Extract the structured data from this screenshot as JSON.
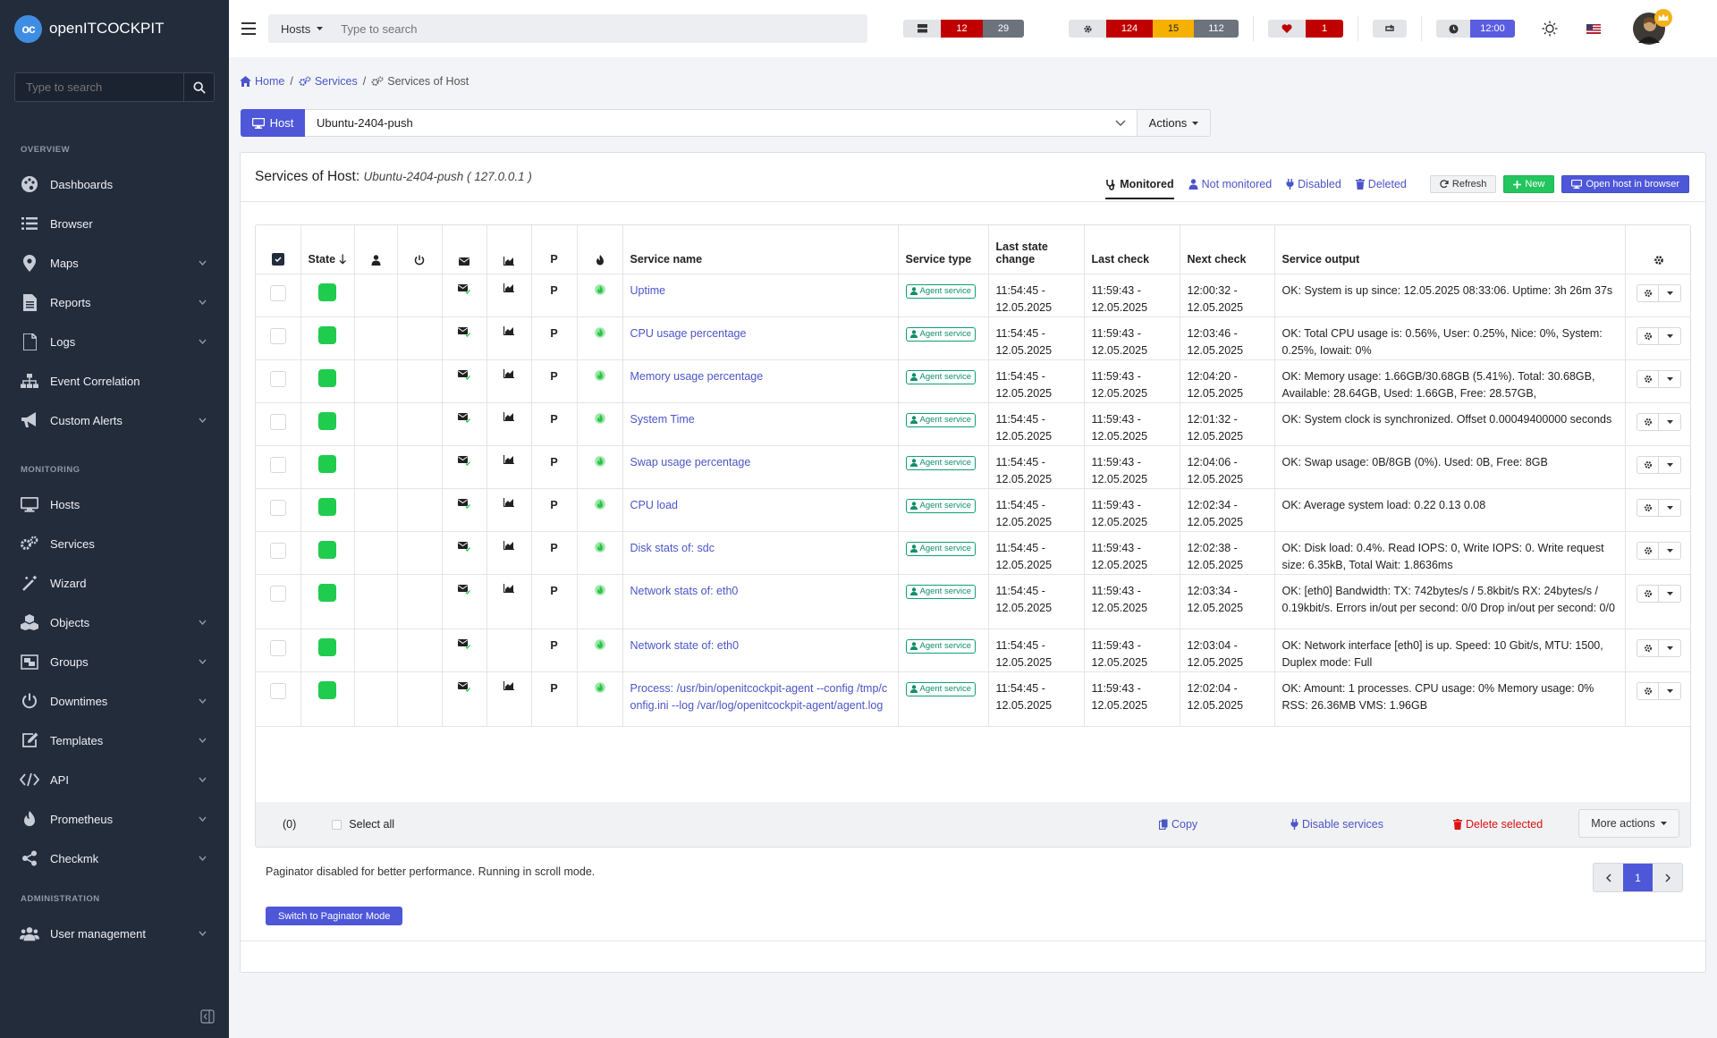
{
  "app": {
    "logo_text": "openITCOCKPIT",
    "logo_mark": "oc"
  },
  "sidebar": {
    "search_placeholder": "Type to search",
    "sections": {
      "overview": "OVERVIEW",
      "monitoring": "MONITORING",
      "administration": "ADMINISTRATION"
    },
    "overview_items": [
      {
        "label": "Dashboards",
        "icon": "palette-icon",
        "chevron": false
      },
      {
        "label": "Browser",
        "icon": "list-icon",
        "chevron": false
      },
      {
        "label": "Maps",
        "icon": "map-pin-icon",
        "chevron": true
      },
      {
        "label": "Reports",
        "icon": "file-report-icon",
        "chevron": true
      },
      {
        "label": "Logs",
        "icon": "file-icon",
        "chevron": true
      },
      {
        "label": "Event Correlation",
        "icon": "sitemap-icon",
        "chevron": false
      },
      {
        "label": "Custom Alerts",
        "icon": "bullhorn-icon",
        "chevron": true
      }
    ],
    "monitoring_items": [
      {
        "label": "Hosts",
        "icon": "desktop-icon",
        "chevron": false
      },
      {
        "label": "Services",
        "icon": "gears-icon",
        "chevron": false
      },
      {
        "label": "Wizard",
        "icon": "magic-wand-icon",
        "chevron": false
      },
      {
        "label": "Objects",
        "icon": "cubes-icon",
        "chevron": true
      },
      {
        "label": "Groups",
        "icon": "object-group-icon",
        "chevron": true
      },
      {
        "label": "Downtimes",
        "icon": "power-icon",
        "chevron": true
      },
      {
        "label": "Templates",
        "icon": "edit-icon",
        "chevron": true
      },
      {
        "label": "API",
        "icon": "code-icon",
        "chevron": true
      },
      {
        "label": "Prometheus",
        "icon": "fire-icon",
        "chevron": true
      },
      {
        "label": "Checkmk",
        "icon": "share-icon",
        "chevron": true
      }
    ],
    "administration_items": [
      {
        "label": "User management",
        "icon": "users-icon",
        "chevron": true
      }
    ]
  },
  "topbar": {
    "search_type": "Hosts",
    "search_placeholder": "Type to search",
    "host_counts": {
      "down": "12",
      "unreachable": "29"
    },
    "service_counts": {
      "critical": "124",
      "warning": "15",
      "unknown": "112"
    },
    "health_count": "1",
    "clock": "12:00",
    "colors": {
      "red": "#c00000",
      "amber": "#f6b000",
      "gray": "#6c737d",
      "purple": "#5a5de0"
    }
  },
  "breadcrumb": {
    "home": "Home",
    "services": "Services",
    "current": "Services of Host"
  },
  "hostbar": {
    "host_button": "Host",
    "selected_host": "Ubuntu-2404-push",
    "actions": "Actions"
  },
  "card": {
    "title_prefix": "Services of Host:",
    "title_host": "Ubuntu-2404-push ( 127.0.0.1 )",
    "tabs": {
      "monitored": "Monitored",
      "not_monitored": "Not monitored",
      "disabled": "Disabled",
      "deleted": "Deleted"
    },
    "buttons": {
      "refresh": "Refresh",
      "new": "New",
      "open": "Open host in browser"
    }
  },
  "table": {
    "headers": {
      "state": "State",
      "p": "P",
      "service_name": "Service name",
      "service_type": "Service type",
      "last_state_change": "Last state change",
      "last_check": "Last check",
      "next_check": "Next check",
      "service_output": "Service output"
    },
    "rows": [
      {
        "name": "Uptime",
        "type": "Agent service",
        "last_change": "11:54:45 - 12.05.2025",
        "last_check": "11:59:43 - 12.05.2025",
        "next_check": "12:00:32 - 12.05.2025",
        "output": "OK: System is up since: 12.05.2025 08:33:06. Uptime: 3h 26m 37s",
        "graph": true,
        "p": "P"
      },
      {
        "name": "CPU usage percentage",
        "type": "Agent service",
        "last_change": "11:54:45 - 12.05.2025",
        "last_check": "11:59:43 - 12.05.2025",
        "next_check": "12:03:46 - 12.05.2025",
        "output": "OK: Total CPU usage is: 0.56%, User: 0.25%, Nice: 0%, System: 0.25%, Iowait: 0%",
        "graph": true,
        "p": "P"
      },
      {
        "name": "Memory usage percentage",
        "type": "Agent service",
        "last_change": "11:54:45 - 12.05.2025",
        "last_check": "11:59:43 - 12.05.2025",
        "next_check": "12:04:20 - 12.05.2025",
        "output": "OK: Memory usage: 1.66GB/30.68GB (5.41%). Total: 30.68GB, Available: 28.64GB, Used: 1.66GB, Free: 28.57GB,",
        "graph": true,
        "p": "P"
      },
      {
        "name": "System Time",
        "type": "Agent service",
        "last_change": "11:54:45 - 12.05.2025",
        "last_check": "11:59:43 - 12.05.2025",
        "next_check": "12:01:32 - 12.05.2025",
        "output": "OK: System clock is synchronized. Offset 0.00049400000 seconds",
        "graph": true,
        "p": "P"
      },
      {
        "name": "Swap usage percentage",
        "type": "Agent service",
        "last_change": "11:54:45 - 12.05.2025",
        "last_check": "11:59:43 - 12.05.2025",
        "next_check": "12:04:06 - 12.05.2025",
        "output": "OK: Swap usage: 0B/8GB (0%). Used: 0B, Free: 8GB",
        "graph": true,
        "p": "P"
      },
      {
        "name": "CPU load",
        "type": "Agent service",
        "last_change": "11:54:45 - 12.05.2025",
        "last_check": "11:59:43 - 12.05.2025",
        "next_check": "12:02:34 - 12.05.2025",
        "output": "OK: Average system load: 0.22 0.13 0.08",
        "graph": true,
        "p": "P"
      },
      {
        "name": "Disk stats of: sdc",
        "type": "Agent service",
        "last_change": "11:54:45 - 12.05.2025",
        "last_check": "11:59:43 - 12.05.2025",
        "next_check": "12:02:38 - 12.05.2025",
        "output": "OK: Disk load: 0.4%. Read IOPS: 0, Write IOPS: 0. Write request size: 6.35kB, Total Wait: 1.8636ms",
        "graph": true,
        "p": "P"
      },
      {
        "name": "Network stats of: eth0",
        "type": "Agent service",
        "last_change": "11:54:45 - 12.05.2025",
        "last_check": "11:59:43 - 12.05.2025",
        "next_check": "12:03:34 - 12.05.2025",
        "output": "OK: [eth0] Bandwidth: TX: 742bytes/s / 5.8kbit/s RX: 24bytes/s / 0.19kbit/s. Errors in/out per second: 0/0 Drop in/out per second: 0/0",
        "graph": true,
        "p": "P"
      },
      {
        "name": "Network state of: eth0",
        "type": "Agent service",
        "last_change": "11:54:45 - 12.05.2025",
        "last_check": "11:59:43 - 12.05.2025",
        "next_check": "12:03:04 - 12.05.2025",
        "output": "OK: Network interface [eth0] is up. Speed: 10 Gbit/s, MTU: 1500, Duplex mode: Full",
        "graph": false,
        "p": "P"
      },
      {
        "name": "Process: /usr/bin/openitcockpit-agent --config /tmp/config.ini --log /var/log/openitcockpit-agent/agent.log",
        "type": "Agent service",
        "last_change": "11:54:45 - 12.05.2025",
        "last_check": "11:59:43 - 12.05.2025",
        "next_check": "12:02:04 - 12.05.2025",
        "output": "OK: Amount: 1 processes. CPU usage: 0% Memory usage: 0% RSS: 26.36MB VMS: 1.96GB",
        "graph": true,
        "p": "P"
      }
    ],
    "footer": {
      "count": "(0)",
      "select_all": "Select all",
      "copy": "Copy",
      "disable": "Disable services",
      "delete": "Delete selected",
      "more": "More actions"
    }
  },
  "paginator": {
    "info": "Paginator disabled for better performance. Running in scroll mode.",
    "current_page": "1",
    "switch": "Switch to Paginator Mode"
  }
}
